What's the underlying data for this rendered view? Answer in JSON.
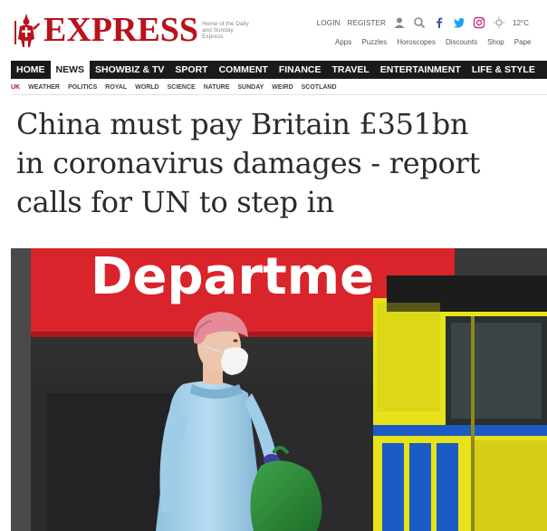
{
  "masthead": {
    "logo_text": "EXPRESS",
    "logo_subtext": "Home of the Daily and Sunday Express",
    "top_links": [
      "LOGIN",
      "REGISTER"
    ],
    "temperature": "12°C",
    "sub_links": [
      "Apps",
      "Puzzles",
      "Horoscopes",
      "Discounts",
      "Shop",
      "Pape"
    ],
    "icons": [
      "user-icon",
      "search-icon",
      "facebook-icon",
      "twitter-icon",
      "instagram-icon",
      "weather-icon"
    ]
  },
  "main_nav": {
    "items": [
      "HOME",
      "NEWS",
      "SHOWBIZ & TV",
      "SPORT",
      "COMMENT",
      "FINANCE",
      "TRAVEL",
      "ENTERTAINMENT",
      "LIFE & STYLE"
    ],
    "active": "NEWS"
  },
  "section_nav": {
    "items": [
      "UK",
      "WEATHER",
      "POLITICS",
      "ROYAL",
      "WORLD",
      "SCIENCE",
      "NATURE",
      "SUNDAY",
      "WEIRD",
      "SCOTLAND"
    ],
    "active": "UK"
  },
  "article": {
    "headline_lines": [
      "China must pay Britain £351bn",
      "in coronavirus damages - report",
      "calls for UN to step in"
    ]
  },
  "hero_image": {
    "sign_text": "Departme"
  },
  "colors": {
    "brand_red": "#b8121a",
    "nav_bg": "#1a1a1a",
    "sign_red": "#d8242a",
    "ambulance_yellow": "#e8e21a"
  }
}
